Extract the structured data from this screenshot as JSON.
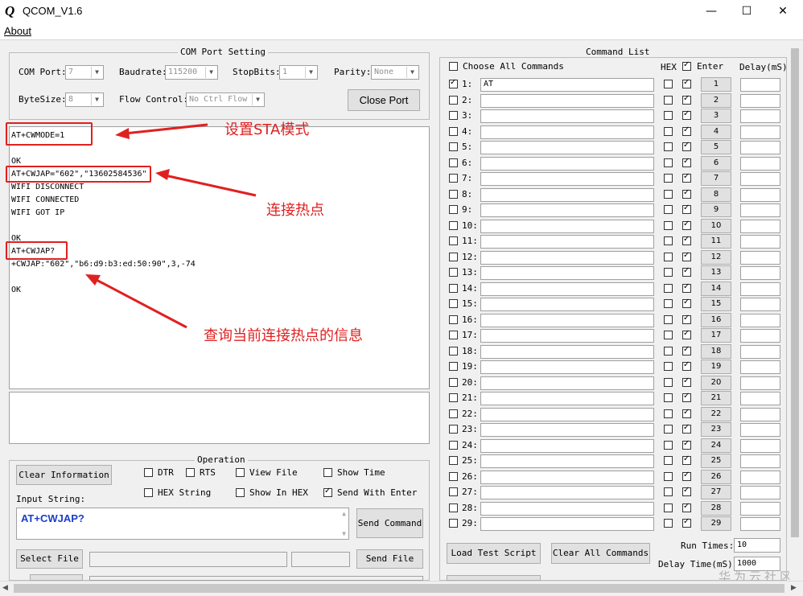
{
  "window": {
    "title": "QCOM_V1.6",
    "logo": "Q",
    "minimize": "—",
    "maximize": "☐",
    "close": "✕"
  },
  "menu": {
    "about": "About"
  },
  "com_port": {
    "group_title": "COM Port Setting",
    "com_port_label": "COM Port:",
    "com_port_value": "7",
    "baudrate_label": "Baudrate:",
    "baudrate_value": "115200",
    "stopbits_label": "StopBits:",
    "stopbits_value": "1",
    "parity_label": "Parity:",
    "parity_value": "None",
    "bytesize_label": "ByteSize:",
    "bytesize_value": "8",
    "flow_label": "Flow Control:",
    "flow_value": "No Ctrl Flow",
    "close_port": "Close Port"
  },
  "terminal": {
    "lines": [
      "AT+CWMODE=1",
      "",
      "OK",
      "AT+CWJAP=\"602\",\"13602584536\"",
      "WIFI DISCONNECT",
      "WIFI CONNECTED",
      "WIFI GOT IP",
      "",
      "OK",
      "AT+CWJAP?",
      "+CWJAP:\"602\",\"b6:d9:b3:ed:50:90\",3,-74",
      "",
      "OK"
    ]
  },
  "annotations": {
    "a1": "设置STA模式",
    "a2": "连接热点",
    "a3": "查询当前连接热点的信息"
  },
  "operation": {
    "group_title": "Operation",
    "clear_info": "Clear Information",
    "dtr": "DTR",
    "rts": "RTS",
    "view_file": "View File",
    "show_time": "Show Time",
    "hex_string": "HEX String",
    "show_in_hex": "Show In HEX",
    "send_with_enter": "Send With Enter",
    "input_label": "Input String:",
    "input_value": "AT+CWJAP?",
    "send_command": "Send Command",
    "select_file": "Select File",
    "send_file": "Send File"
  },
  "command_list": {
    "group_title": "Command List",
    "choose_all": "Choose All Commands",
    "hex_header": "HEX",
    "enter_header": "Enter",
    "delay_header": "Delay(mS)",
    "row1_value": "AT",
    "load_test_script": "Load Test Script",
    "clear_all": "Clear All Commands",
    "run_times_label": "Run Times:",
    "run_times_value": "10",
    "delay_time_label": "Delay Time(mS):",
    "delay_time_value": "1000"
  },
  "watermark": "华为云社区"
}
